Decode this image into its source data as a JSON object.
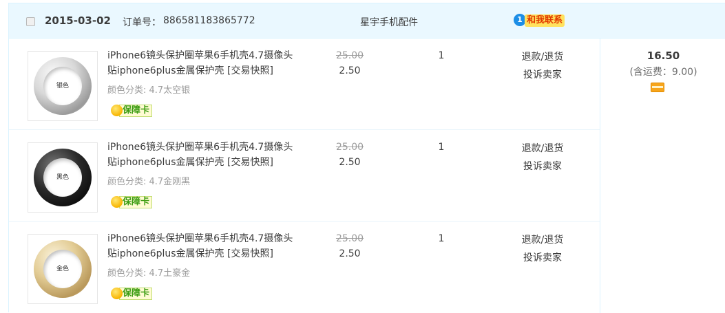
{
  "order": {
    "date": "2015-03-02",
    "order_no_label": "订单号：",
    "order_no": "886581183865772",
    "shop_name": "星宇手机配件",
    "contact_badge": "1",
    "contact_label": "和我联系",
    "total": "16.50",
    "shipping": "(含运费：9.00)",
    "pay_icon": "payment-card-icon"
  },
  "items": [
    {
      "thumb_label": "银色",
      "title": "iPhone6镜头保护圈苹果6手机壳4.7摄像头贴iphone6plus金属保护壳",
      "snapshot": "[交易快照]",
      "spec": "颜色分类: 4.7太空银",
      "guarantee": "保障卡",
      "orig_price": "25.00",
      "price": "2.50",
      "qty": "1",
      "op_refund": "退款/退货",
      "op_complain": "投诉卖家"
    },
    {
      "thumb_label": "黑色",
      "title": "iPhone6镜头保护圈苹果6手机壳4.7摄像头贴iphone6plus金属保护壳",
      "snapshot": "[交易快照]",
      "spec": "颜色分类: 4.7金刚黑",
      "guarantee": "保障卡",
      "orig_price": "25.00",
      "price": "2.50",
      "qty": "1",
      "op_refund": "退款/退货",
      "op_complain": "投诉卖家"
    },
    {
      "thumb_label": "金色",
      "title": "iPhone6镜头保护圈苹果6手机壳4.7摄像头贴iphone6plus金属保护壳",
      "snapshot": "[交易快照]",
      "spec": "颜色分类: 4.7土豪金",
      "guarantee": "保障卡",
      "orig_price": "25.00",
      "price": "2.50",
      "qty": "1",
      "op_refund": "退款/退货",
      "op_complain": "投诉卖家"
    }
  ]
}
